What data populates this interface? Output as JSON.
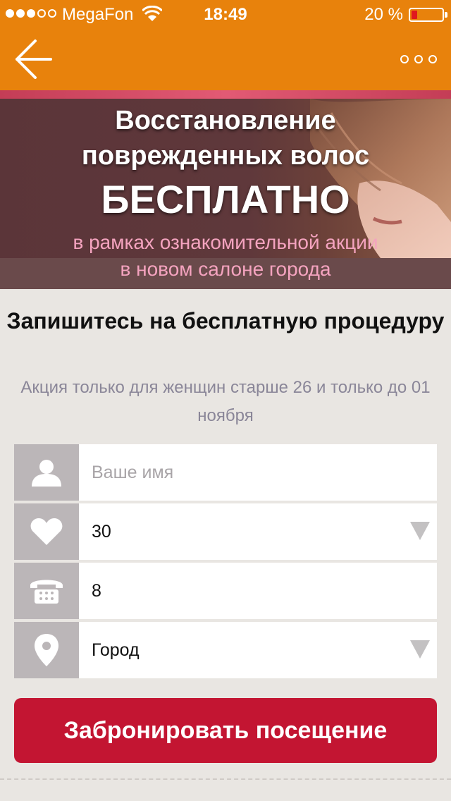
{
  "status_bar": {
    "carrier": "MegaFon",
    "time": "18:49",
    "battery_percent": "20 %",
    "battery_level": 0.2,
    "signal_bars_filled": 3,
    "signal_bars_total": 5
  },
  "nav": {
    "back_icon": "arrow-left-icon",
    "more_icon": "more-dots-icon"
  },
  "banner": {
    "title_line1": "Восстановление",
    "title_line2": "поврежденных волос",
    "title_line3": "БЕСПЛАТНО",
    "subtitle_line1": "в рамках ознакомительной акции",
    "subtitle_line2": "в новом салоне города"
  },
  "form": {
    "heading": "Запишитесь на бесплатную процедуру",
    "note": "Акция только для женщин старше 26 и только до 01 ноября",
    "name_placeholder": "Ваше имя",
    "age_value": "30",
    "phone_value": "8",
    "city_value": "Город",
    "submit_label": "Забронировать посещение"
  },
  "colors": {
    "top_bar": "#e8820c",
    "submit": "#c31532",
    "banner_subtitle": "#f4a3bf",
    "note_text": "#8a8698",
    "icon_bg": "#bbb6b8"
  }
}
